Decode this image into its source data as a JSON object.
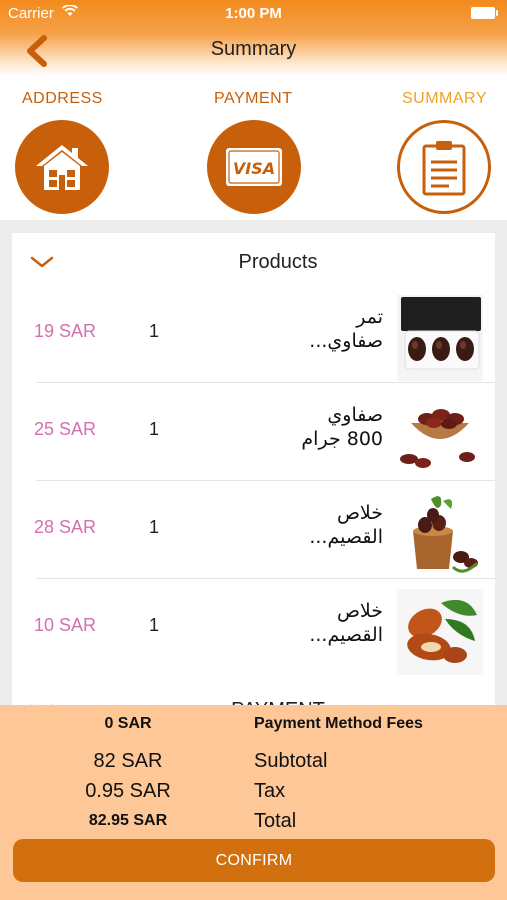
{
  "status_bar": {
    "carrier": "Carrier",
    "time": "1:00 PM"
  },
  "nav": {
    "title": "Summary",
    "back_icon": "chevron-left-icon"
  },
  "steps": [
    {
      "label": "ADDRESS",
      "icon": "house-icon",
      "state": "done"
    },
    {
      "label": "PAYMENT",
      "icon": "visa-card-icon",
      "state": "done"
    },
    {
      "label": "SUMMARY",
      "icon": "clipboard-icon",
      "state": "active"
    }
  ],
  "products_section": {
    "title": "Products",
    "items": [
      {
        "price": "19 SAR",
        "qty": "1",
        "name_line1": "تمر",
        "name_line2": "صفاوي..."
      },
      {
        "price": "25 SAR",
        "qty": "1",
        "name_line1": "صفاوي",
        "name_line2": "800 جرام"
      },
      {
        "price": "28 SAR",
        "qty": "1",
        "name_line1": "خلاص",
        "name_line2": "القصيم..."
      },
      {
        "price": "10 SAR",
        "qty": "1",
        "name_line1": "خلاص",
        "name_line2": "القصيم..."
      }
    ]
  },
  "payment_section": {
    "title": "PAYMENT"
  },
  "summary": {
    "fee_value": "0 SAR",
    "fee_label": "Payment Method Fees",
    "subtotal_value": "82 SAR",
    "subtotal_label": "Subtotal",
    "tax_value": "0.95 SAR",
    "tax_label": "Tax",
    "total_value": "82.95 SAR",
    "total_label": "Total",
    "confirm_label": "CONFIRM"
  },
  "colors": {
    "brand": "#c85f0b",
    "accent": "#f0a024",
    "price": "#d46fb0",
    "summary_bg": "#fdc797",
    "button": "#d2700f"
  }
}
